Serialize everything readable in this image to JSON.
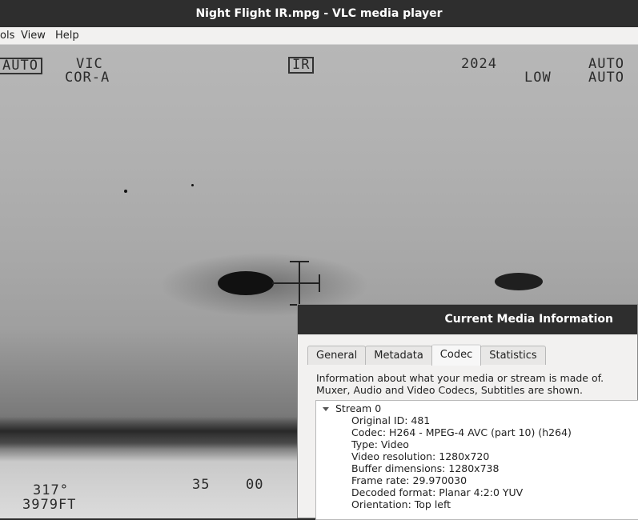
{
  "window": {
    "title": "Night Flight IR.mpg - VLC media player"
  },
  "menu": {
    "tools": "ols",
    "view": "View",
    "help": "Help"
  },
  "hud": {
    "top_left_box": "AUTO",
    "vic": "VIC",
    "cor": "COR-A",
    "ir_box": "IR",
    "num_2024": "2024",
    "low": "LOW",
    "auto_right_1": "AUTO",
    "auto_right_2": "AUTO",
    "heading": "317°",
    "altitude": "3979FT",
    "scale_35": "35",
    "scale_00": "00"
  },
  "dialog": {
    "title": "Current Media Information",
    "tabs": [
      "General",
      "Metadata",
      "Codec",
      "Statistics"
    ],
    "active_tab": "Codec",
    "description_line1": "Information about what your media or stream is made of.",
    "description_line2": "Muxer, Audio and Video Codecs, Subtitles are shown.",
    "stream_label": "Stream 0",
    "stream_items": [
      "Original ID: 481",
      "Codec: H264 - MPEG-4 AVC (part 10) (h264)",
      "Type: Video",
      "Video resolution: 1280x720",
      "Buffer dimensions: 1280x738",
      "Frame rate: 29.970030",
      "Decoded format: Planar 4:2:0 YUV",
      "Orientation: Top left"
    ]
  }
}
